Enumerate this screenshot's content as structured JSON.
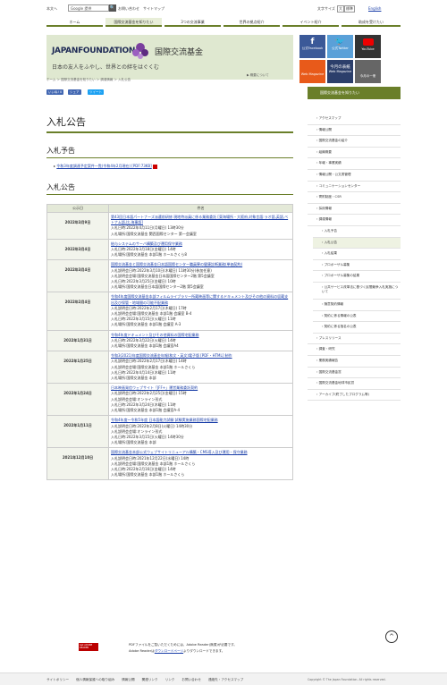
{
  "topbar": {
    "site_label": "本文へ",
    "search_value": "Google 提供",
    "search_btn": "🔍",
    "inquiry": "お問い合わせ",
    "sitemap": "サイトマップ",
    "font_size": "文字サイズ",
    "font_large": "大",
    "font_std": "標準",
    "english": "English"
  },
  "nav": [
    "ホーム",
    "国際交流基金を知りたい",
    "3つの交流事業",
    "世界の拠点紹介",
    "イベント紹介",
    "助成を受けたい"
  ],
  "banner": {
    "logo": "JAPANFOUNDATION",
    "logo_jp": "国際交流基金",
    "tagline": "日本の友人をふやし、世界との絆をはぐくむ",
    "about": "▶ 概要について"
  },
  "social": {
    "facebook": "公式Facebook",
    "twitter": "公式Twitter",
    "youtube": "YouTube",
    "magazine_sub": "Web Magazine",
    "monthly": "今月の表紙",
    "monthly_sub": "Web Magazine",
    "more": "今月の一冊"
  },
  "breadcrumb": "ホーム ＞ 国際交流基金を知りたい ＞ 調達情報 ＞ 入札公告",
  "share": {
    "like": "いいね! 0",
    "share": "シェア",
    "tweet": "ツイート"
  },
  "page_title": "入札公告",
  "section1": {
    "title": "入札予告",
    "link": "令和3年度調達予定案件一覧(令和4年2月現在) [PDF:73KB]"
  },
  "section2": {
    "title": "入札公告"
  },
  "table": {
    "headers": [
      "公示日",
      "件名"
    ],
    "rows": [
      {
        "date": "2022年3月9日",
        "title": "第43回日本語パートナーズ派遣前研修 現地特派員に係る業務委託 [東海場所・大阪府,対象言語:ラオ語,英語,ベトナム語,比,海事語]",
        "lines": [
          "入札日時:2022年4月11日(月曜日) 13時30分",
          "入札場所:国際交流基金 関西国際センター 第一会議室"
        ]
      },
      {
        "date": "2022年3月4日",
        "title": "給与システムのサーバ構築及び運用保守業務",
        "lines": [
          "入札日時:2022年3月18日(金曜日) 14時",
          "入札場所:国際交流基金 本部1階 ホールさくら8"
        ]
      },
      {
        "date": "2022年3月4日",
        "title": "国際交流基金と国際交流基金日本語国際センター職員寮の健康診断業務(単価契約)",
        "lines": [
          "入札説明会日時:2022年3月10日(木曜日) 11時30分(参加任意)",
          "入札説明会会場:国際交流基金日本語国際センター2階 第5会議室",
          "入札日時:2022年3月25日(金曜日) 10時",
          "入札場所:国際交流基金日本語国際センター2階 第5会議室"
        ]
      },
      {
        "date": "2022年2月4日",
        "title": "令和4年度国際交流基金本部フィルムライブラリー所蔵映画等に関するドキュメント及びその他の資料の収蔵支出及び保管・地域間の可能不配業務",
        "lines": [
          "入札説明会日時:2022年2月17日(木曜日) 17時",
          "入札説明会会場:国際交流基金 本部1階 会議室 B-4",
          "入札日時:2022年3月15日(火曜日) 11時",
          "入札場所:国際交流基金 本部1階 会議室 A-3"
        ]
      },
      {
        "date": "2022年1月31日",
        "title": "令和4年度ドキュメント及びその他資料の国際宅配業務",
        "lines": [
          "入札日時:2022年3月22日(火曜日) 14時",
          "入札場所:国際交流基金 本部1階 会議室A4"
        ]
      },
      {
        "date": "2022年1月25日",
        "title": "令和3(2021)年度国際交流基金年報(和文・英文)電子版 [PDF・HTML] 制作",
        "lines": [
          "入札説明会日時:2022年2月17日(木曜日) 14時",
          "入札説明会会場:国際交流基金 本部1階 ホールさくら",
          "入札日時:2022年4月14日(木曜日) 11時",
          "入札場所:国際交流基金 本部"
        ]
      },
      {
        "date": "2022年1月24日",
        "title": "日本映画発信ウェブサイト「JFF+」運営業務委託契約",
        "lines": [
          "入札説明会日時:2022年2月25日(金曜日) 15時",
          "入札説明会会場:オンライン形式",
          "入札日時:2022年3月24日(木曜日) 11時",
          "入札場所:国際交流基金 本部1階 会議室A-4"
        ]
      },
      {
        "date": "2022年1月11日",
        "title": "令和4年度～令和5年度 日本語能力試験 試験実施業務国際宅配業務",
        "lines": [
          "入札説明会日時:2022年2月8日(火曜日) 14時30分",
          "入札説明会会場:オンライン形式",
          "入札日時:2022年3月15日(火曜日) 14時30分",
          "入札場所:国際交流基金 本部"
        ]
      },
      {
        "date": "2021年12月10日",
        "title": "国際交流基金本部公式ウェブサイトリニューアル構築・CMS導入及び運用・保守業務",
        "lines": [
          "入札説明会日時:2021年12月22日(水曜日) 14時",
          "入札説明会会場:国際交流基金 本部1階 ホールさくら",
          "入札日時:2022年2月16日(金曜日) 14時",
          "入札場所:国際交流基金 本部1階 ホールさくら"
        ]
      }
    ]
  },
  "pdf_note": {
    "badge": "Get ADOBE READER",
    "line1": "PDFファイルをご覧いただくためには、Adobe Reader(無償)が必要です。",
    "line2_pre": "Adobe Readerは",
    "line2_link": "ダウンロードページ",
    "line2_post": "よりダウンロードできます。"
  },
  "sidebar": {
    "header": "国際交流基金を知りたい",
    "items": [
      {
        "label": "アクセスマップ",
        "child": false
      },
      {
        "label": "情報公開",
        "child": false
      },
      {
        "label": "国際交流基金の紹介",
        "child": false
      },
      {
        "label": "組織概要",
        "child": false
      },
      {
        "label": "年報・事業実績",
        "child": false
      },
      {
        "label": "情報公開・公文書管理",
        "child": false
      },
      {
        "label": "コミュニケーションセンター",
        "child": false
      },
      {
        "label": "寄附制度・CSR",
        "child": false
      },
      {
        "label": "採用情報",
        "child": false
      },
      {
        "label": "調達情報",
        "child": false
      },
      {
        "label": "入札予告",
        "child": true
      },
      {
        "label": "入札公告",
        "child": true,
        "current": true
      },
      {
        "label": "入札結果",
        "child": true
      },
      {
        "label": "プロポーザル募集",
        "child": true
      },
      {
        "label": "プロポーザル募集の結果",
        "child": true
      },
      {
        "label": "公共サービス改革法に基づく民間競争入札実施について",
        "child": true
      },
      {
        "label": "随意契約情報",
        "child": true
      },
      {
        "label": "契約に係る情報の公表",
        "child": true
      },
      {
        "label": "契約に係る指名の公表",
        "child": true
      },
      {
        "label": "プレスリリース",
        "child": false
      },
      {
        "label": "調査・研究",
        "child": false
      },
      {
        "label": "業務実績報告",
        "child": false
      },
      {
        "label": "国際交流基金賞",
        "child": false
      },
      {
        "label": "国際交流基金地球市民賞",
        "child": false
      },
      {
        "label": "アーカイブ(終了したプログラム等)",
        "child": false
      }
    ]
  },
  "footer": [
    "サイトポリシー",
    "個人情報保護への取り組み",
    "情報公開",
    "関連リンク",
    "リンク",
    "お問い合わせ",
    "連絡先・アクセスマップ"
  ],
  "copyright": "Copyright © The Japan Foundation. All rights reserved.",
  "gotop": "^"
}
